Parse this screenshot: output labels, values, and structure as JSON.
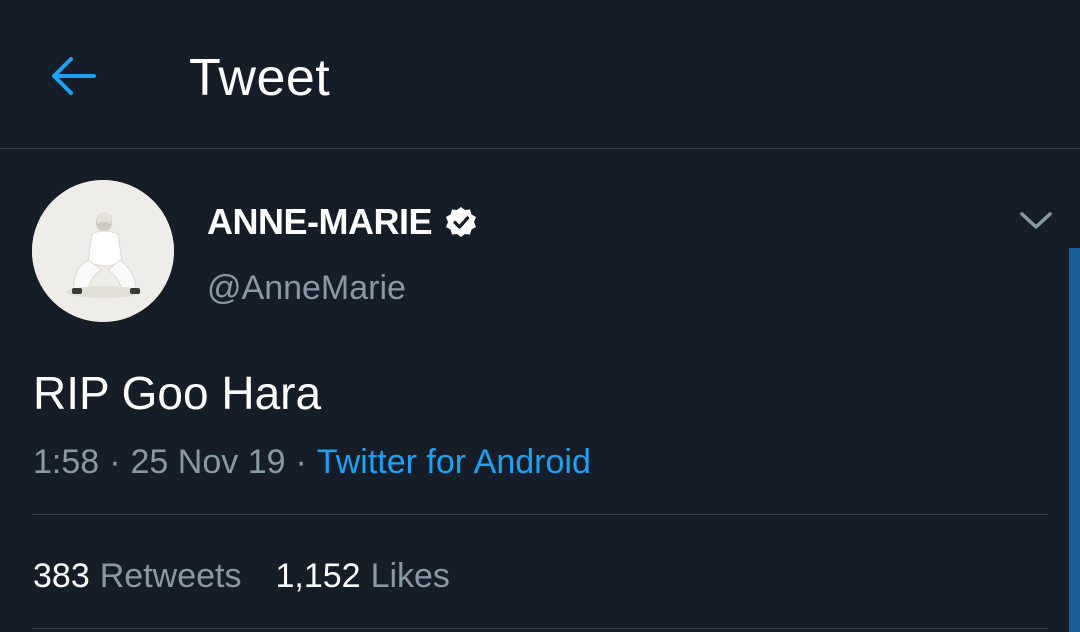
{
  "header": {
    "title": "Tweet",
    "back_icon": "back-arrow-icon"
  },
  "colors": {
    "background": "#151d28",
    "accent": "#1da1f2",
    "secondary_text": "#8899a6",
    "divider": "#38444d"
  },
  "tweet": {
    "author_name": "ANNE-MARIE",
    "verified": true,
    "handle": "@AnneMarie",
    "text": "RIP Goo Hara",
    "time": "1:58",
    "date": "25 Nov 19",
    "separator": "·",
    "source": "Twitter for Android",
    "stats": {
      "retweets_count": "383",
      "retweets_label": "Retweets",
      "likes_count": "1,152",
      "likes_label": "Likes"
    }
  }
}
